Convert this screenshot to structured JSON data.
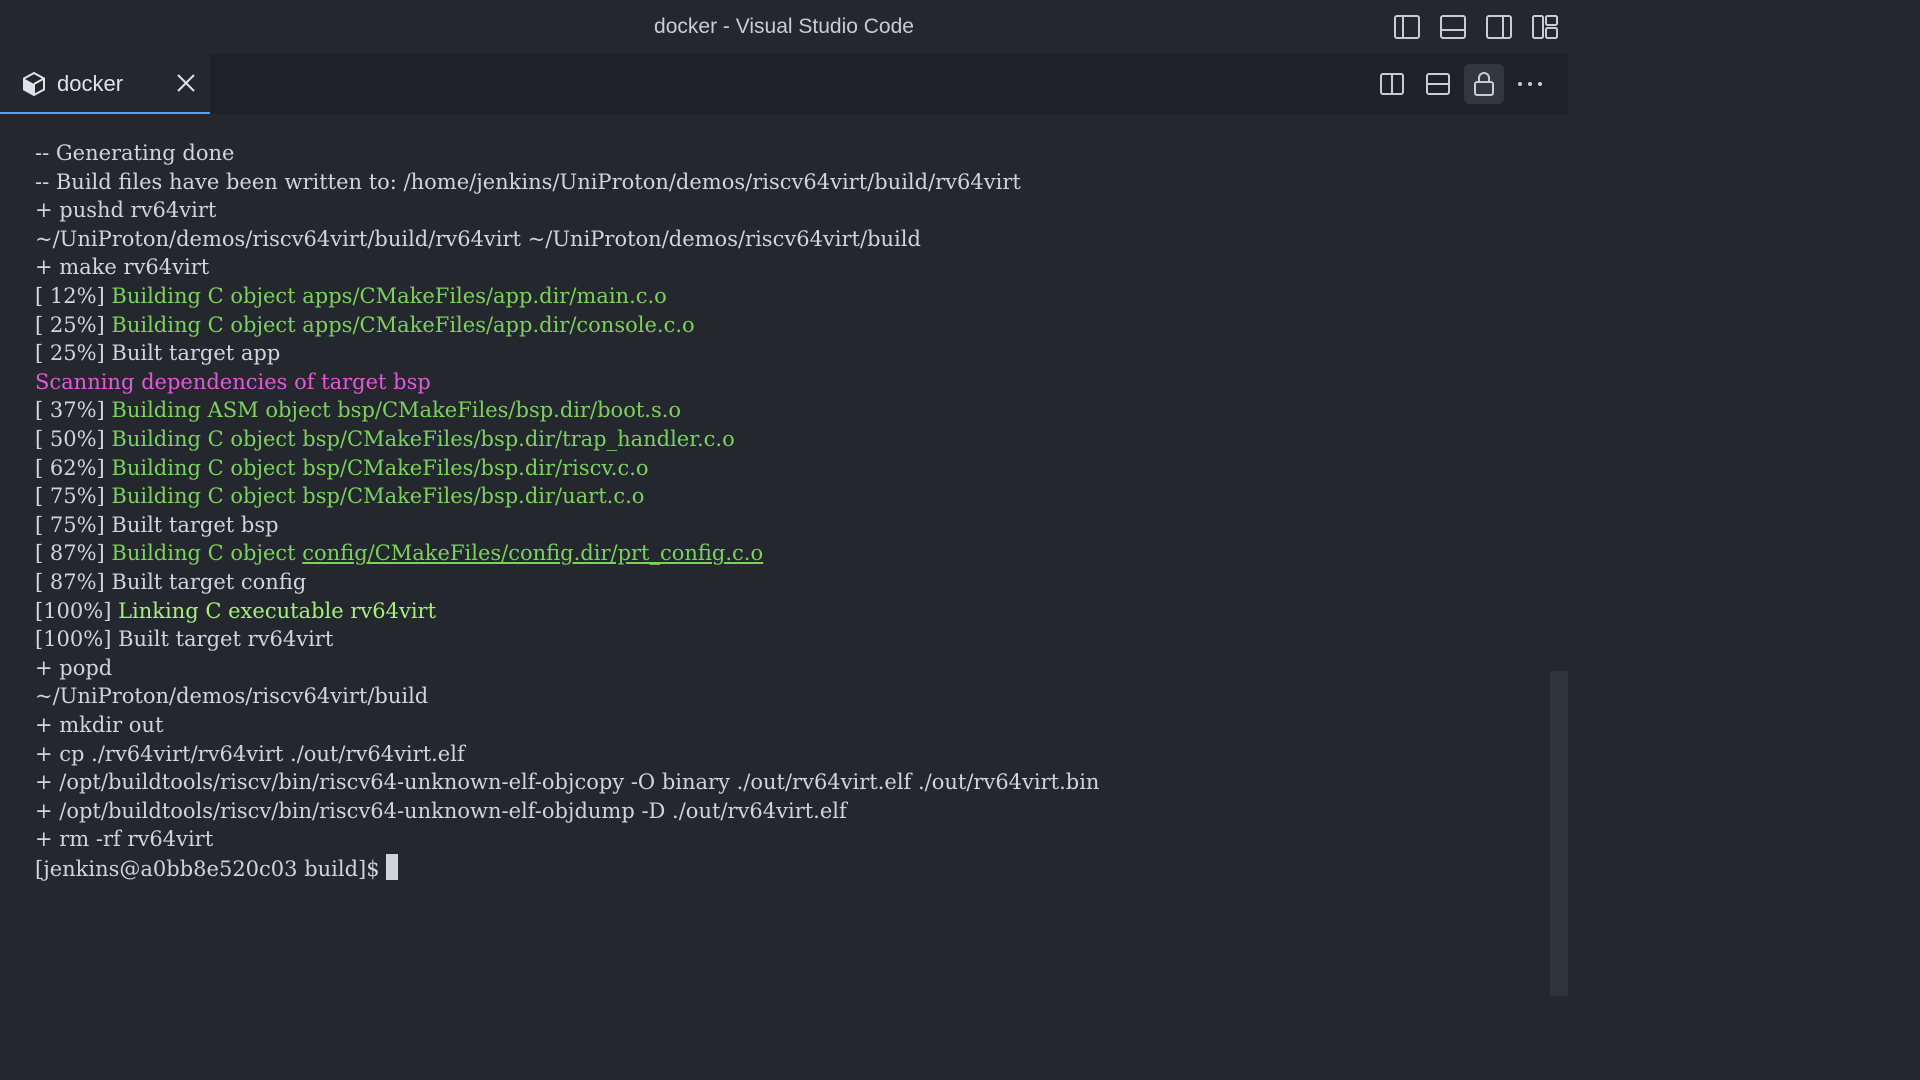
{
  "window": {
    "title": "docker - Visual Studio Code"
  },
  "title_icons": [
    "toggle-primary-sidebar-icon",
    "toggle-panel-icon",
    "toggle-secondary-sidebar-icon",
    "customize-layout-icon"
  ],
  "tab": {
    "label": "docker",
    "icon": "terminal-icon"
  },
  "editor_actions": [
    "split-editor-right-icon",
    "split-editor-down-icon",
    "lock-icon",
    "more-actions-icon"
  ],
  "colors": {
    "accent": "#4aa3ff",
    "green": "#7bd35c",
    "bright_green": "#a6f07a",
    "magenta": "#e35ad8",
    "text": "#d0d4db"
  },
  "terminal": {
    "lines": [
      {
        "segments": [
          {
            "text": "-- Generating done"
          }
        ]
      },
      {
        "segments": [
          {
            "text": "-- Build files have been written to: /home/jenkins/UniProton/demos/riscv64virt/build/rv64virt"
          }
        ]
      },
      {
        "segments": [
          {
            "text": "+ pushd rv64virt"
          }
        ]
      },
      {
        "segments": [
          {
            "text": "~/UniProton/demos/riscv64virt/build/rv64virt ~/UniProton/demos/riscv64virt/build"
          }
        ]
      },
      {
        "segments": [
          {
            "text": "+ make rv64virt"
          }
        ]
      },
      {
        "segments": [
          {
            "text": "[ 12%] "
          },
          {
            "text": "Building C object apps/CMakeFiles/app.dir/main.c.o",
            "style": "green"
          }
        ]
      },
      {
        "segments": [
          {
            "text": "[ 25%] "
          },
          {
            "text": "Building C object apps/CMakeFiles/app.dir/console.c.o",
            "style": "green"
          }
        ]
      },
      {
        "segments": [
          {
            "text": "[ 25%] Built target app"
          }
        ]
      },
      {
        "segments": [
          {
            "text": "Scanning dependencies of target bsp",
            "style": "magenta"
          }
        ]
      },
      {
        "segments": [
          {
            "text": "[ 37%] "
          },
          {
            "text": "Building ASM object bsp/CMakeFiles/bsp.dir/boot.s.o",
            "style": "green"
          }
        ]
      },
      {
        "segments": [
          {
            "text": "[ 50%] "
          },
          {
            "text": "Building C object bsp/CMakeFiles/bsp.dir/trap_handler.c.o",
            "style": "green"
          }
        ]
      },
      {
        "segments": [
          {
            "text": "[ 62%] "
          },
          {
            "text": "Building C object bsp/CMakeFiles/bsp.dir/riscv.c.o",
            "style": "green"
          }
        ]
      },
      {
        "segments": [
          {
            "text": "[ 75%] "
          },
          {
            "text": "Building C object bsp/CMakeFiles/bsp.dir/uart.c.o",
            "style": "green"
          }
        ]
      },
      {
        "segments": [
          {
            "text": "[ 75%] Built target bsp"
          }
        ]
      },
      {
        "segments": [
          {
            "text": "[ 87%] "
          },
          {
            "text": "Building C object ",
            "style": "green"
          },
          {
            "text": "config/CMakeFiles/config.dir/prt_config.c.o",
            "style": "link"
          }
        ]
      },
      {
        "segments": [
          {
            "text": "[ 87%] Built target config"
          }
        ]
      },
      {
        "segments": [
          {
            "text": "[100%] "
          },
          {
            "text": "Linking C executable rv64virt",
            "style": "bgreen"
          }
        ]
      },
      {
        "segments": [
          {
            "text": "[100%] Built target rv64virt"
          }
        ]
      },
      {
        "segments": [
          {
            "text": "+ popd"
          }
        ]
      },
      {
        "segments": [
          {
            "text": "~/UniProton/demos/riscv64virt/build"
          }
        ]
      },
      {
        "segments": [
          {
            "text": "+ mkdir out"
          }
        ]
      },
      {
        "segments": [
          {
            "text": "+ cp ./rv64virt/rv64virt ./out/rv64virt.elf"
          }
        ]
      },
      {
        "segments": [
          {
            "text": "+ /opt/buildtools/riscv/bin/riscv64-unknown-elf-objcopy -O binary ./out/rv64virt.elf ./out/rv64virt.bin"
          }
        ]
      },
      {
        "segments": [
          {
            "text": "+ /opt/buildtools/riscv/bin/riscv64-unknown-elf-objdump -D ./out/rv64virt.elf"
          }
        ]
      },
      {
        "segments": [
          {
            "text": "+ rm -rf rv64virt"
          }
        ]
      }
    ],
    "prompt": "[jenkins@a0bb8e520c03 build]$"
  }
}
